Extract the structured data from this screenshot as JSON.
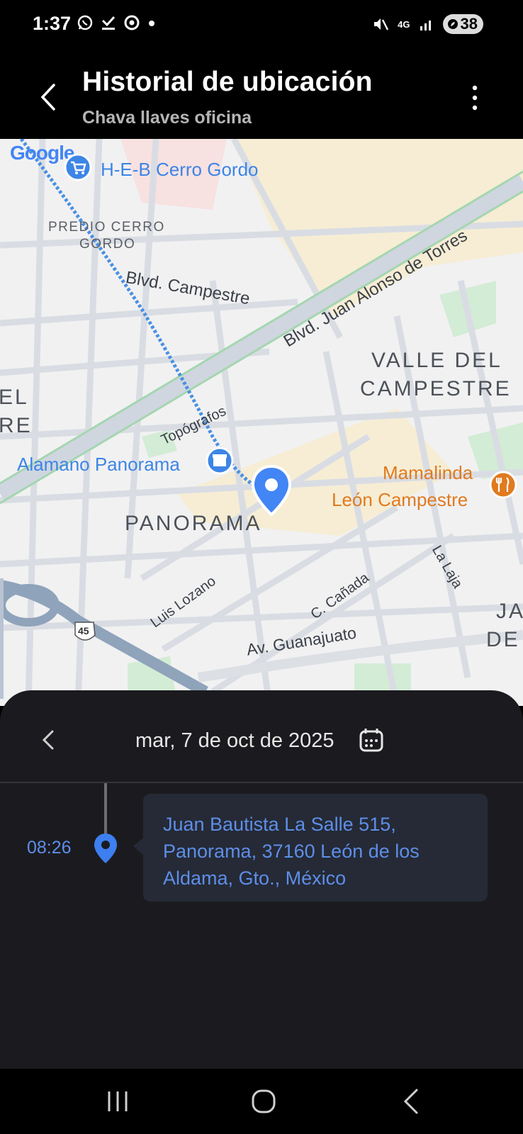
{
  "status_bar": {
    "time": "1:37",
    "network": "4G",
    "battery": "38",
    "icons_left": [
      "whatsapp-icon",
      "check-download-icon",
      "chrome-icon",
      "dot-icon"
    ],
    "icons_right": [
      "mute-icon",
      "4g-icon",
      "signal-icon",
      "battery-icon"
    ]
  },
  "header": {
    "title": "Historial de ubicación",
    "subtitle": "Chava llaves oficina",
    "back_icon": "back-arrow-icon",
    "menu_icon": "more-vertical-icon"
  },
  "map": {
    "logo": "Google",
    "places": {
      "heb": "H-E-B Cerro Gordo",
      "predio_line1": "PREDIO CERRO",
      "predio_line2": "GORDO",
      "campestre": "Blvd. Campestre",
      "juan_alonso": "Blvd. Juan Alonso de Torres",
      "valle_line1": "VALLE DEL",
      "valle_line2": "CAMPESTRE",
      "el": "EL",
      "re": "RE",
      "topografos": "Topógrafos",
      "alamano": "Alamano Panorama",
      "panorama": "PANORAMA",
      "mamalinda_line1": "Mamalinda",
      "mamalinda_line2": "León Campestre",
      "la_laja": "La Laja",
      "luis_lozano": "Luis Lozano",
      "c_canada": "C. Cañada",
      "av_guanajuato": "Av. Guanajuato",
      "ja": "JA",
      "de": "DE",
      "highway": "45"
    },
    "colors": {
      "pin": "#4285f4",
      "poi_blue": "#3d85e6",
      "poi_orange": "#e07a1f",
      "route": "#4a90e2"
    }
  },
  "sheet": {
    "date": "mar, 7 de oct de 2025",
    "prev_icon": "chevron-left-icon",
    "calendar_icon": "calendar-icon",
    "entries": [
      {
        "time": "08:26",
        "address": "Juan Bautista La Salle 515, Panorama, 37160 León de los Aldama, Gto., México"
      }
    ]
  },
  "nav_bar": {
    "recents_icon": "recents-icon",
    "home_icon": "home-icon",
    "back_icon": "nav-back-icon"
  }
}
